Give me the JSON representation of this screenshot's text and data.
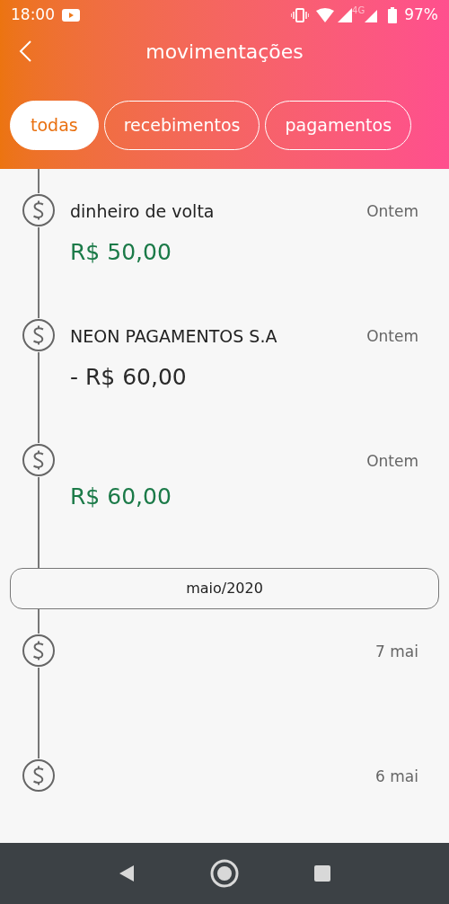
{
  "status_bar": {
    "time": "18:00",
    "network": "4G",
    "battery": "97%"
  },
  "header": {
    "title": "movimentações"
  },
  "tabs": [
    {
      "label": "todas",
      "selected": true
    },
    {
      "label": "recebimentos",
      "selected": false
    },
    {
      "label": "pagamentos",
      "selected": false
    }
  ],
  "transactions": [
    {
      "name": "dinheiro de volta",
      "amount": "R$ 50,00",
      "kind": "credit",
      "date": "Ontem"
    },
    {
      "name": "NEON PAGAMENTOS S.A",
      "amount": "- R$ 60,00",
      "kind": "debit",
      "date": "Ontem"
    },
    {
      "amount": "R$ 60,00",
      "kind": "credit",
      "date": "Ontem"
    }
  ],
  "month_divider": "maio/2020",
  "older_transactions": [
    {
      "date": "7 mai"
    },
    {
      "date": "6 mai"
    }
  ]
}
